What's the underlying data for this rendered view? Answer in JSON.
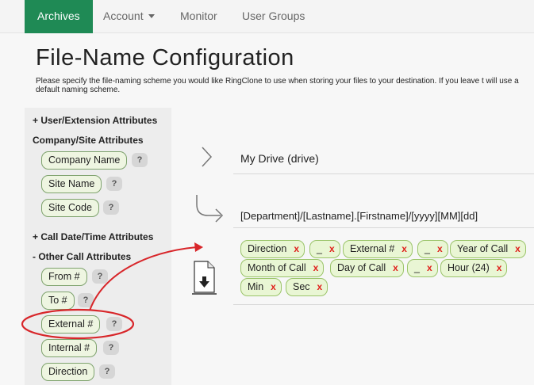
{
  "nav": {
    "archives": "Archives",
    "account": "Account",
    "monitor": "Monitor",
    "user_groups": "User Groups"
  },
  "page": {
    "title": "File-Name Configuration",
    "description": "Please specify the file-naming scheme you would like RingClone to use when storing your files to your destination. If you leave t will use a default naming scheme."
  },
  "attributes": {
    "user_ext": "+ User/Extension Attributes",
    "company_site": "Company/Site Attributes",
    "company_site_items": [
      "Company Name",
      "Site Name",
      "Site Code"
    ],
    "call_datetime": "+ Call Date/Time Attributes",
    "other_call": "- Other Call Attributes",
    "other_call_items": [
      "From #",
      "To #",
      "External #",
      "Internal #",
      "Direction"
    ],
    "help_glyph": "?"
  },
  "config": {
    "drive": "My Drive (drive)",
    "path": "[Department]/[Lastname].[Firstname]/[yyyy][MM][dd]",
    "remove_glyph": "x",
    "tokens": [
      "Direction",
      "_",
      "External #",
      "_",
      "Year of Call",
      "Month of Call",
      "Day of Call",
      "_",
      "Hour (24)",
      "Min",
      "Sec"
    ]
  },
  "annotation": {
    "highlight_color": "#d8262a"
  },
  "icons": {
    "drive_arrow": "chevron-right-icon",
    "path_arrow": "return-arrow-icon",
    "file_icon": "file-download-icon"
  }
}
